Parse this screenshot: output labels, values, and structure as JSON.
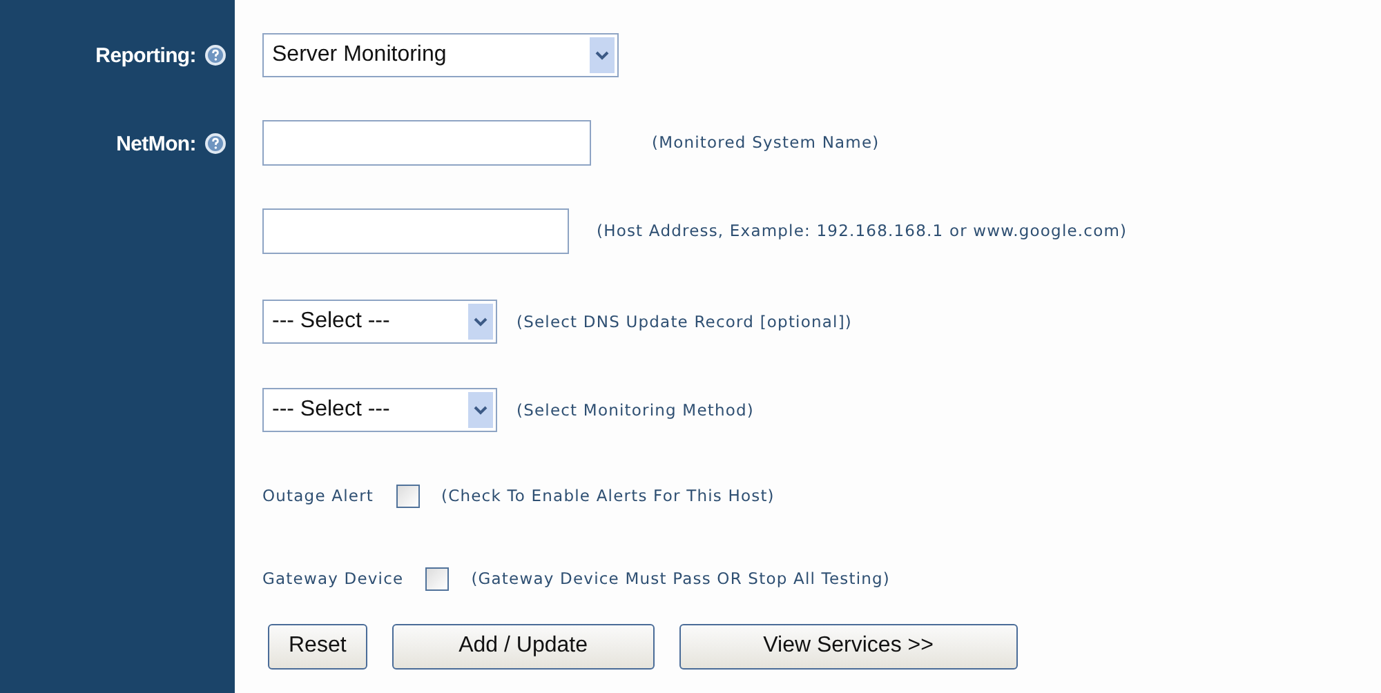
{
  "sidebar": {
    "labels": [
      "Reporting:",
      "NetMon:"
    ]
  },
  "rows": [
    {
      "kind": "select",
      "value": "Server Monitoring"
    },
    {
      "kind": "text",
      "hint": "(Monitored System Name)"
    },
    {
      "kind": "text",
      "hint": "(Host Address, Example: 192.168.168.1 or www.google.com)"
    },
    {
      "kind": "select",
      "value": "--- Select ---",
      "hint": "(Select DNS Update Record [optional])"
    },
    {
      "kind": "select",
      "value": "--- Select ---",
      "hint": "(Select Monitoring Method)"
    },
    {
      "kind": "checkbox",
      "label": "Outage Alert",
      "checked": false,
      "hint": "(Check To Enable Alerts For This Host)"
    },
    {
      "kind": "checkbox",
      "label": "Gateway Device",
      "checked": false,
      "hint": "(Gateway Device Must Pass OR Stop All Testing)"
    }
  ],
  "buttons": [
    "Reset",
    "Add / Update",
    "View Services >>"
  ]
}
